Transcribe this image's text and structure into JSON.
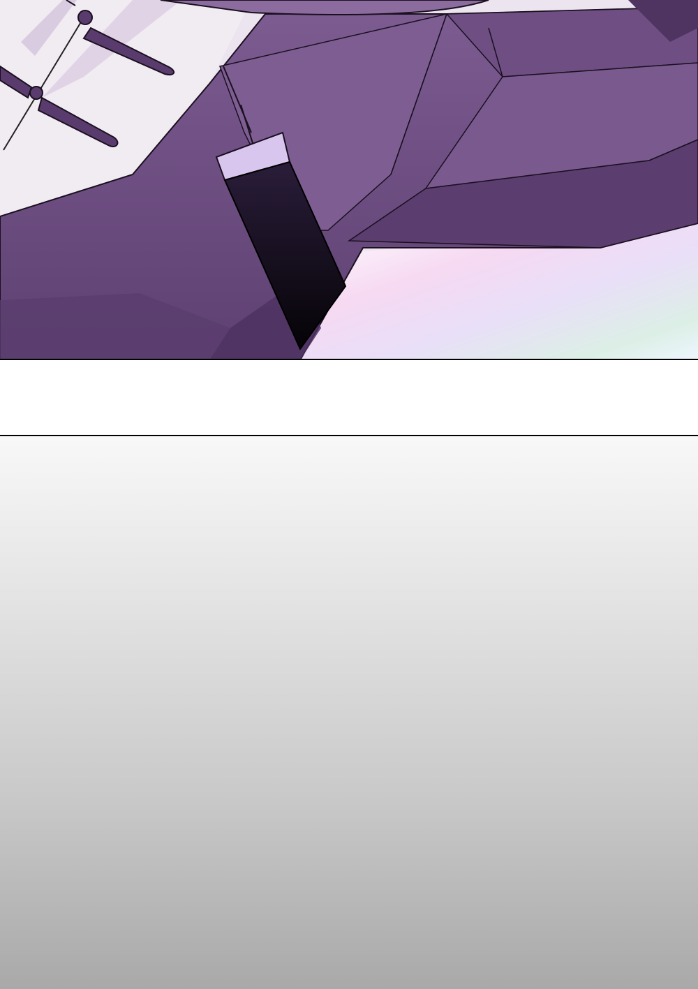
{
  "page": {
    "background": "#ffffff",
    "panels": [
      {
        "name": "top-illustration-panel",
        "content": "purple-robe-with-black-tassel",
        "colors": {
          "robe_light": "#7b5a8f",
          "robe_mid": "#6b4b80",
          "robe_dark": "#553768",
          "tassel_cap": "#d9c6ee",
          "tassel_cord": "#120d1a",
          "backdrop_pale": "#ece4ee",
          "rainbow_tint": [
            "#f6d9f2",
            "#e9dff8",
            "#dcefe6"
          ]
        }
      },
      {
        "name": "gutter",
        "content": "blank"
      },
      {
        "name": "bottom-gradient-panel",
        "content": "blank-gray-gradient",
        "colors": {
          "gradient_top": "#f8f8f8",
          "gradient_bottom": "#a9a9a9"
        }
      }
    ]
  }
}
